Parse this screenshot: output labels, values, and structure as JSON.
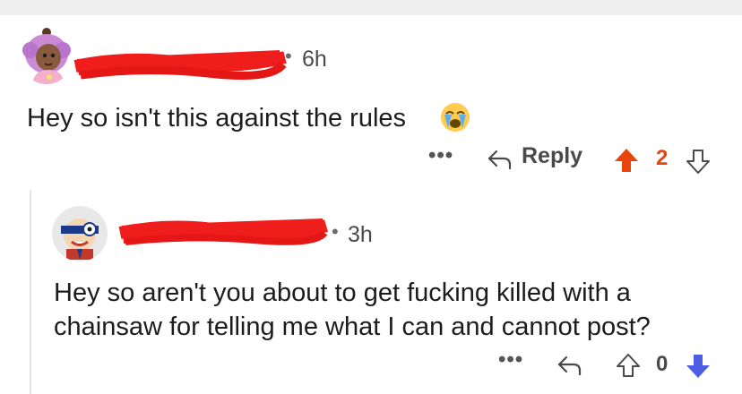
{
  "comment": {
    "time": "6h",
    "text": "Hey so isn't this against the rules",
    "emoji": "loudly-crying-face",
    "more_label": "•••",
    "reply_label": "Reply",
    "vote_count": "2",
    "vote_state": "upvoted",
    "upvote_color": "#e8450c"
  },
  "reply": {
    "time": "3h",
    "text": "Hey so aren't you about to get fucking killed with a chainsaw for telling me what I can and cannot post?",
    "more_label": "•••",
    "vote_count": "0",
    "vote_state": "downvoted",
    "downvote_color": "#4e5ee4"
  },
  "separator": "•"
}
